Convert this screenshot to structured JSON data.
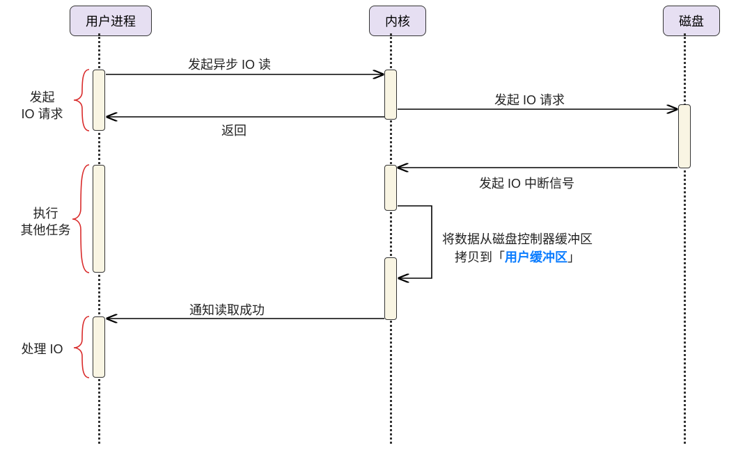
{
  "participants": {
    "user_process": "用户进程",
    "kernel": "内核",
    "disk": "磁盘"
  },
  "side_labels": {
    "request_io": {
      "line1": "发起",
      "line2": "IO 请求"
    },
    "other_tasks": {
      "line1": "执行",
      "line2": "其他任务"
    },
    "handle_io": "处理 IO"
  },
  "messages": {
    "async_read": "发起异步 IO 读",
    "return": "返回",
    "io_request_to_disk": "发起 IO 请求",
    "io_interrupt": "发起 IO 中断信号",
    "copy_data_line1": "将数据从磁盘控制器缓冲区",
    "copy_data_prefix": "拷贝到「",
    "copy_data_highlight": "用户缓冲区",
    "copy_data_suffix": "」",
    "notify_success": "通知读取成功"
  },
  "layout": {
    "lane_x": {
      "user": 142,
      "kernel": 561,
      "disk": 983
    }
  }
}
